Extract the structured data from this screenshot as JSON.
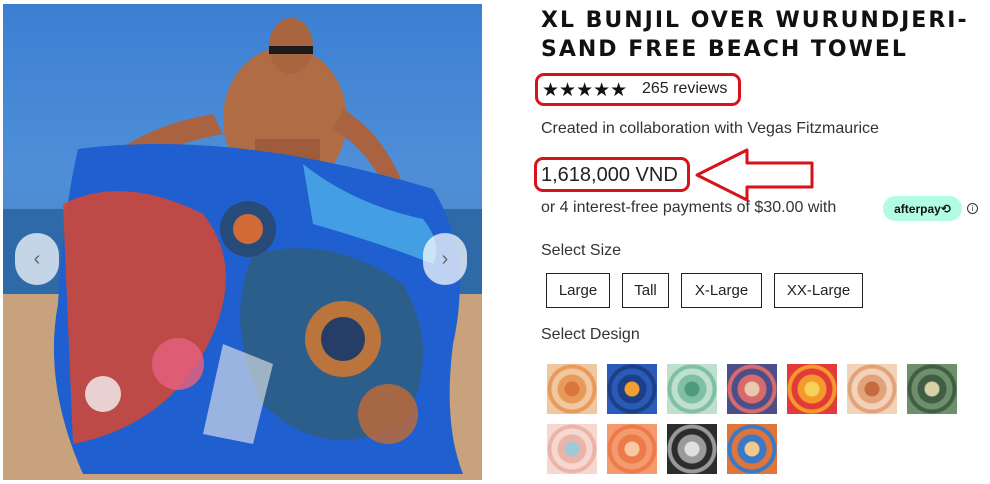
{
  "product": {
    "title": "XL BUNJIL OVER WURUNDJERI- SAND FREE BEACH TOWEL",
    "stars": "★★★★★",
    "reviews_label": "265 reviews",
    "collaboration": "Created in collaboration with Vegas Fitzmaurice",
    "price": "1,618,000 VND",
    "installments": "or 4 interest-free payments of $30.00 with",
    "afterpay_label": "afterpay⟲",
    "info_icon": "i"
  },
  "gallery": {
    "prev_icon": "‹",
    "next_icon": "›"
  },
  "size": {
    "label": "Select Size",
    "options": [
      "Large",
      "Tall",
      "X-Large",
      "XX-Large"
    ]
  },
  "design": {
    "label": "Select Design",
    "swatches": [
      {
        "name": "swatch-1",
        "colors": [
          "#f0c8a0",
          "#e89a5a",
          "#d9763b"
        ]
      },
      {
        "name": "swatch-2",
        "colors": [
          "#2a5bb8",
          "#1c3f86",
          "#f0a030"
        ]
      },
      {
        "name": "swatch-3",
        "colors": [
          "#bfe0cf",
          "#7fbfa3",
          "#4e9a80"
        ]
      },
      {
        "name": "swatch-4",
        "colors": [
          "#4a4f8c",
          "#d86a6a",
          "#e9c8b0"
        ]
      },
      {
        "name": "swatch-5",
        "colors": [
          "#e23a3a",
          "#f59a2a",
          "#f5d35a"
        ]
      },
      {
        "name": "swatch-6",
        "colors": [
          "#f2d2b8",
          "#e2a27a",
          "#c46a3e"
        ]
      },
      {
        "name": "swatch-7",
        "colors": [
          "#6f8f6a",
          "#3f5e45",
          "#d9d0a8"
        ]
      },
      {
        "name": "swatch-8",
        "colors": [
          "#f6d8d0",
          "#ecb4a8",
          "#9fc9d8"
        ]
      },
      {
        "name": "swatch-9",
        "colors": [
          "#f39b6e",
          "#ee7a4a",
          "#f8c8a0"
        ]
      },
      {
        "name": "swatch-10",
        "colors": [
          "#2c2c2c",
          "#9a9a9a",
          "#e0e0e0"
        ]
      },
      {
        "name": "swatch-11",
        "colors": [
          "#e0743a",
          "#3a78c8",
          "#f0c890"
        ]
      }
    ]
  },
  "annotations": {
    "highlight_color": "#d8121b"
  }
}
